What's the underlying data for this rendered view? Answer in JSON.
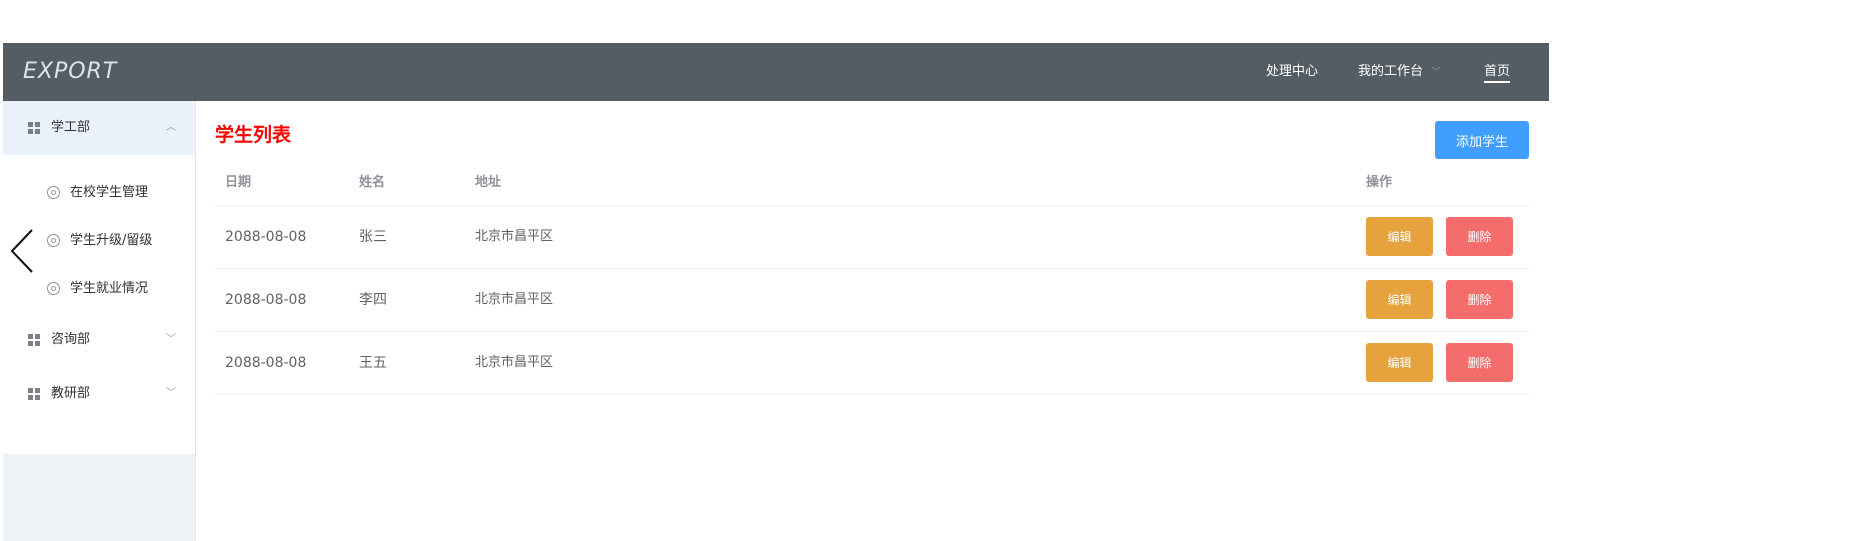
{
  "header": {
    "logo": "EXPORT",
    "nav": [
      {
        "label": "处理中心"
      },
      {
        "label": "我的工作台",
        "chevron": "﹀"
      },
      {
        "label": "首页"
      }
    ]
  },
  "sidebar": {
    "groups": [
      {
        "label": "学工部",
        "expanded": true,
        "arrow": "︿",
        "items": [
          "在校学生管理",
          "学生升级/留级",
          "学生就业情况"
        ]
      },
      {
        "label": "咨询部",
        "expanded": false,
        "arrow": "﹀"
      },
      {
        "label": "教研部",
        "expanded": false,
        "arrow": "﹀"
      }
    ]
  },
  "main": {
    "title": "学生列表",
    "add_button": "添加学生",
    "columns": {
      "date": "日期",
      "name": "姓名",
      "address": "地址",
      "ops": "操作"
    },
    "rows": [
      {
        "date": "2088-08-08",
        "name": "张三",
        "address": "北京市昌平区"
      },
      {
        "date": "2088-08-08",
        "name": "李四",
        "address": "北京市昌平区"
      },
      {
        "date": "2088-08-08",
        "name": "王五",
        "address": "北京市昌平区"
      }
    ],
    "edit_label": "编辑",
    "delete_label": "删除"
  },
  "colors": {
    "header_bg": "#545c64",
    "title": "#ff0000",
    "primary": "#409eff",
    "warning": "#e6a23c",
    "danger": "#f56c6c"
  }
}
